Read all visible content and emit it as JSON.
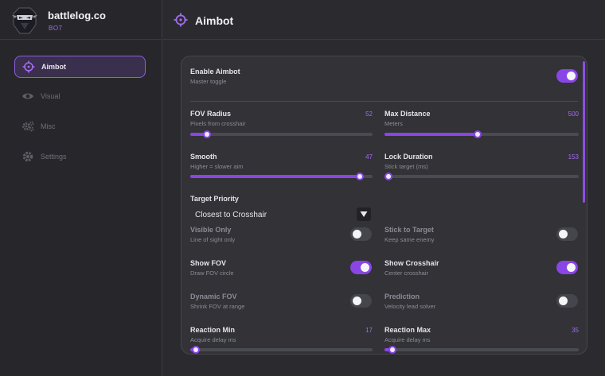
{
  "app": {
    "name": "battlelog.co",
    "subtitle": "BO7"
  },
  "sidebar": {
    "items": [
      {
        "label": "Aimbot",
        "icon": "crosshair-icon",
        "active": true
      },
      {
        "label": "Visual",
        "icon": "eye-icon",
        "active": false
      },
      {
        "label": "Misc",
        "icon": "gears-icon",
        "active": false
      },
      {
        "label": "Settings",
        "icon": "gear-icon",
        "active": false
      }
    ]
  },
  "header": {
    "title": "Aimbot",
    "icon": "crosshair-icon"
  },
  "colors": {
    "accent": "#8a45e6",
    "accent_text": "#a46cf0",
    "background": "#2b2b2f",
    "panel": "#323237"
  },
  "enable": {
    "label": "Enable Aimbot",
    "sub": "Master toggle",
    "on": true
  },
  "sliders": {
    "fov_radius": {
      "label": "FOV Radius",
      "sub": "Pixels from crosshair",
      "value": "52",
      "fraction": 0.09
    },
    "max_distance": {
      "label": "Max Distance",
      "sub": "Meters",
      "value": "500",
      "fraction": 0.48
    },
    "smooth": {
      "label": "Smooth",
      "sub": "Higher = slower aim",
      "value": "47",
      "fraction": 0.93
    },
    "lock_duration": {
      "label": "Lock Duration",
      "sub": "Stick target (ms)",
      "value": "153",
      "fraction": 0.02
    },
    "reaction_min": {
      "label": "Reaction Min",
      "sub": "Acquire delay ms",
      "value": "17",
      "fraction": 0.03
    },
    "reaction_max": {
      "label": "Reaction Max",
      "sub": "Acquire delay ms",
      "value": "35",
      "fraction": 0.04
    }
  },
  "target_priority": {
    "label": "Target Priority",
    "value": "Closest to Crosshair"
  },
  "toggles": {
    "visible_only": {
      "label": "Visible Only",
      "sub": "Line of sight only",
      "on": false
    },
    "stick_to_target": {
      "label": "Stick to Target",
      "sub": "Keep same enemy",
      "on": false
    },
    "show_fov": {
      "label": "Show FOV",
      "sub": "Draw FOV circle",
      "on": true
    },
    "show_crosshair": {
      "label": "Show Crosshair",
      "sub": "Center crosshair",
      "on": true
    },
    "dynamic_fov": {
      "label": "Dynamic FOV",
      "sub": "Shrink FOV at range",
      "on": false
    },
    "prediction": {
      "label": "Prediction",
      "sub": "Velocity lead solver",
      "on": false
    }
  }
}
